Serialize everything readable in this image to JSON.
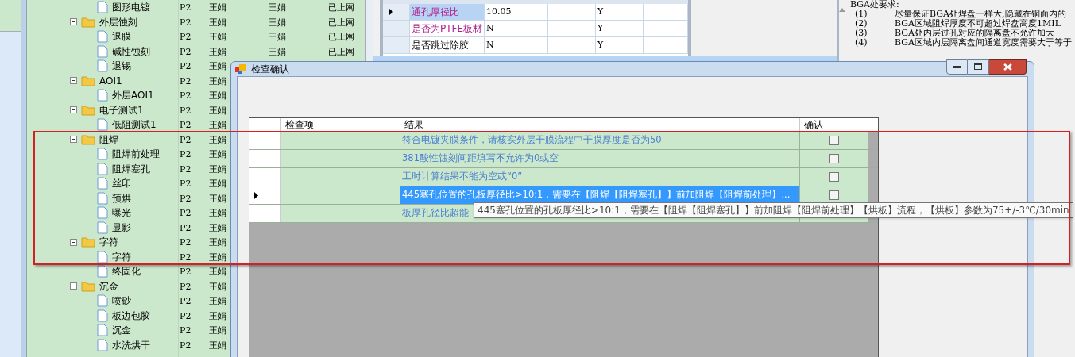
{
  "tree": {
    "items": [
      {
        "kind": "file",
        "label": "图形电镀",
        "cells": [
          "P2",
          "王娟",
          "王娟",
          "已上网"
        ]
      },
      {
        "kind": "folder",
        "label": "外层蚀刻",
        "expanded": true,
        "cells": [
          "P2",
          "王娟",
          "王娟",
          "已上网"
        ],
        "children": [
          {
            "kind": "file",
            "label": "退膜",
            "cells": [
              "P2",
              "王娟",
              "王娟",
              "已上网"
            ]
          },
          {
            "kind": "file",
            "label": "碱性蚀刻",
            "cells": [
              "P2",
              "王娟",
              "王娟",
              "已上网"
            ]
          },
          {
            "kind": "file",
            "label": "退锡",
            "cells": [
              "P2",
              "王娟"
            ]
          }
        ]
      },
      {
        "kind": "folder",
        "label": "AOI1",
        "expanded": true,
        "cells": [
          "P2",
          "王娟"
        ],
        "children": [
          {
            "kind": "file",
            "label": "外层AOI1",
            "cells": [
              "P2",
              "王娟"
            ]
          }
        ]
      },
      {
        "kind": "folder",
        "label": "电子测试1",
        "expanded": true,
        "cells": [
          "P2",
          "王娟"
        ],
        "children": [
          {
            "kind": "file",
            "label": "低阻测试1",
            "cells": [
              "P2",
              "王娟"
            ]
          }
        ]
      },
      {
        "kind": "folder",
        "label": "阻焊",
        "expanded": true,
        "cells": [
          "P2",
          "王娟"
        ],
        "children": [
          {
            "kind": "file",
            "label": "阻焊前处理",
            "cells": [
              "P2",
              "王娟"
            ]
          },
          {
            "kind": "file",
            "label": "阻焊塞孔",
            "cells": [
              "P2",
              "王娟"
            ]
          },
          {
            "kind": "file",
            "label": "丝印",
            "cells": [
              "P2",
              "王娟"
            ]
          },
          {
            "kind": "file",
            "label": "预烘",
            "cells": [
              "P2",
              "王娟"
            ]
          },
          {
            "kind": "file",
            "label": "曝光",
            "cells": [
              "P2",
              "王娟"
            ]
          },
          {
            "kind": "file",
            "label": "显影",
            "cells": [
              "P2",
              "王娟"
            ]
          }
        ]
      },
      {
        "kind": "folder",
        "label": "字符",
        "expanded": true,
        "cells": [
          "P2",
          "王娟"
        ],
        "children": [
          {
            "kind": "file",
            "label": "字符",
            "cells": [
              "P2",
              "王娟"
            ]
          },
          {
            "kind": "file",
            "label": "终固化",
            "cells": [
              "P2",
              "王娟"
            ]
          }
        ]
      },
      {
        "kind": "folder",
        "label": "沉金",
        "expanded": true,
        "cells": [
          "P2",
          "王娟"
        ],
        "children": [
          {
            "kind": "file",
            "label": "喷砂",
            "cells": [
              "P2",
              "王娟"
            ]
          },
          {
            "kind": "file",
            "label": "板边包胶",
            "cells": [
              "P2",
              "王娟"
            ]
          },
          {
            "kind": "file",
            "label": "沉金",
            "cells": [
              "P2",
              "王娟"
            ]
          },
          {
            "kind": "file",
            "label": "水洗烘干",
            "cells": [
              "P2",
              "王娟"
            ]
          }
        ]
      }
    ]
  },
  "param_grid": {
    "rows": [
      {
        "selected": true,
        "flagged": true,
        "cells": [
          "通孔厚径比",
          "10.05",
          "",
          "Y",
          ""
        ]
      },
      {
        "selected": false,
        "flagged": true,
        "cells": [
          "是否为PTFE板材",
          "N",
          "",
          "Y",
          ""
        ]
      },
      {
        "selected": false,
        "flagged": false,
        "cells": [
          "是否跳过除胶",
          "N",
          "",
          "Y",
          ""
        ]
      }
    ]
  },
  "notes": {
    "title": "BGA处要求:",
    "lines": [
      {
        "number": "(1)",
        "text": "尽量保证BGA处焊盘一样大,隐藏在铜面内的"
      },
      {
        "number": "(2)",
        "text": "BGA区域阻焊厚度不可超过焊盘高度1MIL"
      },
      {
        "number": "(3)",
        "text": "BGA处内层过孔对应的隔离盘不允许加大"
      },
      {
        "number": "(4)",
        "text": "BGA区域内层隔离盘间通道宽度需要大于等于"
      }
    ]
  },
  "dialog": {
    "title": "检查确认",
    "columns": [
      "检查项",
      "结果",
      "确认"
    ],
    "rows": [
      {
        "selected": false,
        "item": "",
        "result": "符合电镀夹膜条件，请核实外层干膜流程中干膜厚度是否为50",
        "confirmed": false
      },
      {
        "selected": false,
        "item": "",
        "result": "381酸性蚀刻间距填写不允许为0或空",
        "confirmed": false
      },
      {
        "selected": false,
        "item": "",
        "result": "工时计算结果不能为空或“0”",
        "confirmed": false
      },
      {
        "selected": true,
        "item": "",
        "result": "445塞孔位置的孔板厚径比>10:1，需要在【阻焊【阻焊塞孔】】前加阻焊【阻焊前处理】...",
        "confirmed": false
      },
      {
        "selected": false,
        "item": "",
        "result": "板厚孔径比超能"
      }
    ],
    "tooltip": "445塞孔位置的孔板厚径比>10:1，需要在【阻焊【阻焊塞孔】】前加阻焊【阻焊前处理】【烘板】流程，【烘板】参数为75+/-3℃/30min"
  }
}
